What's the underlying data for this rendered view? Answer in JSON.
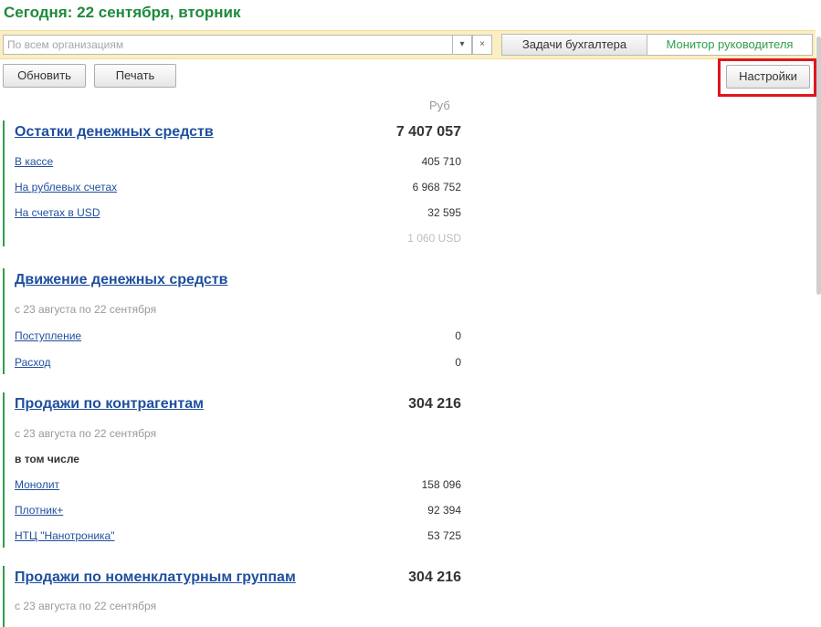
{
  "header": {
    "title": "Сегодня: 22 сентября, вторник"
  },
  "filter": {
    "placeholder": "По всем организациям",
    "dropdown_icon": "▾",
    "clear_icon": "×"
  },
  "tabs": [
    {
      "label": "Задачи бухгалтера"
    },
    {
      "label": "Монитор руководителя"
    }
  ],
  "toolbar": {
    "refresh_label": "Обновить",
    "print_label": "Печать",
    "settings_label": "Настройки"
  },
  "currency_label": "Руб",
  "sections": {
    "cash": {
      "title": "Остатки денежных средств",
      "total": "7 407 057",
      "rows": [
        {
          "label": "В кассе",
          "value": "405 710"
        },
        {
          "label": "На рублевых счетах",
          "value": "6 968 752"
        },
        {
          "label": "На счетах в USD",
          "value": "32 595"
        }
      ],
      "usd_amount": "1 060 USD"
    },
    "flow": {
      "title": "Движение денежных средств",
      "period": "с 23 августа по 22 сентября",
      "rows": [
        {
          "label": "Поступление",
          "value": "0"
        },
        {
          "label": "Расход",
          "value": "0"
        }
      ]
    },
    "sales_counterparties": {
      "title": "Продажи по контрагентам",
      "total": "304 216",
      "period": "с 23 августа по 22 сентября",
      "including": "в том числе",
      "rows": [
        {
          "label": "Монолит",
          "value": "158 096"
        },
        {
          "label": "Плотник+",
          "value": "92 394"
        },
        {
          "label": "НТЦ \"Нанотроника\"",
          "value": "53 725"
        }
      ]
    },
    "sales_groups": {
      "title": "Продажи по номенклатурным группам",
      "total": "304 216",
      "period": "с 23 августа по 22 сентября"
    }
  }
}
